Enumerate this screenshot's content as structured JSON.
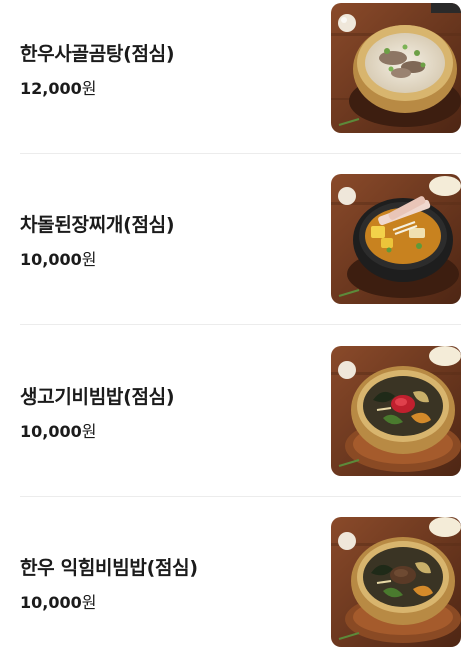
{
  "menu": {
    "items": [
      {
        "name": "한우사골곰탕(점심)",
        "price_num": "12,000",
        "price_unit": "원",
        "image": "beef-bone-soup-photo"
      },
      {
        "name": "차돌된장찌개(점심)",
        "price_num": "10,000",
        "price_unit": "원",
        "image": "brisket-soybean-stew-photo"
      },
      {
        "name": "생고기비빔밥(점심)",
        "price_num": "10,000",
        "price_unit": "원",
        "image": "raw-beef-bibimbap-photo"
      },
      {
        "name": "한우 익힘비빔밥(점심)",
        "price_num": "10,000",
        "price_unit": "원",
        "image": "cooked-beef-bibimbap-photo"
      }
    ]
  },
  "colors": {
    "text": "#1b1b1b",
    "divider": "#ececec",
    "wood": "#6b3a22",
    "brass": "#c9a25c",
    "stone_pot": "#1e1e1e"
  }
}
